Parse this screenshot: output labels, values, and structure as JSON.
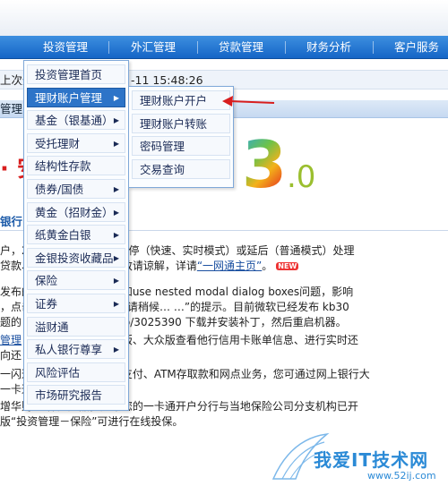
{
  "nav": {
    "items": [
      {
        "label": "投资管理"
      },
      {
        "label": "外汇管理"
      },
      {
        "label": "贷款管理"
      },
      {
        "label": "财务分析"
      },
      {
        "label": "客户服务"
      }
    ]
  },
  "login": {
    "prefix": "上次登",
    "timestamp": "-11 15:48:26"
  },
  "bar2_text": "管理",
  "banner": {
    "left_text": "· 安",
    "big_digit": "3",
    "small_digit": ".0"
  },
  "section": {
    "title": "银行"
  },
  "news": [
    {
      "line1": "户，2         期间，跨行转账会暂停（快速、实时模式）或延后（普通模式）处理",
      "line2": "贷款、              前做好资金安排，敬请谅解，详请",
      "link": "“一网通主页”",
      "line2_end": "。"
    },
    {
      "line1": "发布的              统补丁中涉及到已知use nested modal dialog boxes问题，影响",
      "line2": "，点击           到“正在加载数据，请稍候… …”的提示。目前微软已经发布 kb30",
      "line3": "题的              rt.microsoft.com/kb/3025390 下载并安装补丁，然后重启机器。"
    },
    {
      "line1": "管理",
      "line1b": "              可通过网上银行专业版、大众版查看他行信用卡账单信息、进行实时还",
      "line2": "向还                信用卡。"
    },
    {
      "line1": "一闪通             过手机办理大小额支付、ATM存取款和网点业务，您可通过网上银行大",
      "line2": "一卡通              办理暂停、恢复。"
    },
    {
      "line1": "增华财            型保险产品，如果您的一卡通开户分行与当地保险公司分支机构已开",
      "line2": "版“投资管理－保险”可进行在线投保。"
    }
  ],
  "badge": "NEW",
  "menu_l1": {
    "items": [
      {
        "label": "投资管理首页",
        "has_sub": false
      },
      {
        "label": "理财账户管理",
        "has_sub": true,
        "active": true
      },
      {
        "label": "基金（银基通）",
        "has_sub": true
      },
      {
        "label": "受托理财",
        "has_sub": true
      },
      {
        "label": "结构性存款",
        "has_sub": false
      },
      {
        "label": "债券/国债",
        "has_sub": true
      },
      {
        "label": "黄金（招财金）",
        "has_sub": true
      },
      {
        "label": "纸黄金白银",
        "has_sub": true
      },
      {
        "label": "金银投资收藏品",
        "has_sub": true
      },
      {
        "label": "保险",
        "has_sub": true
      },
      {
        "label": "证券",
        "has_sub": true
      },
      {
        "label": "溢财通",
        "has_sub": false
      },
      {
        "label": "私人银行尊享",
        "has_sub": true
      },
      {
        "label": "风险评估",
        "has_sub": false
      },
      {
        "label": "市场研究报告",
        "has_sub": false
      }
    ]
  },
  "menu_l2": {
    "items": [
      {
        "label": "理财账户开户"
      },
      {
        "label": "理财账户转账"
      },
      {
        "label": "密码管理"
      },
      {
        "label": "交易查询"
      }
    ]
  },
  "watermark": {
    "text": "我爱IT技术网",
    "url": "www.52ij.com"
  },
  "colors": {
    "nav_blue": "#1565c6",
    "menu_active": "#2d74c8",
    "pointer_red": "#d81e1e"
  }
}
